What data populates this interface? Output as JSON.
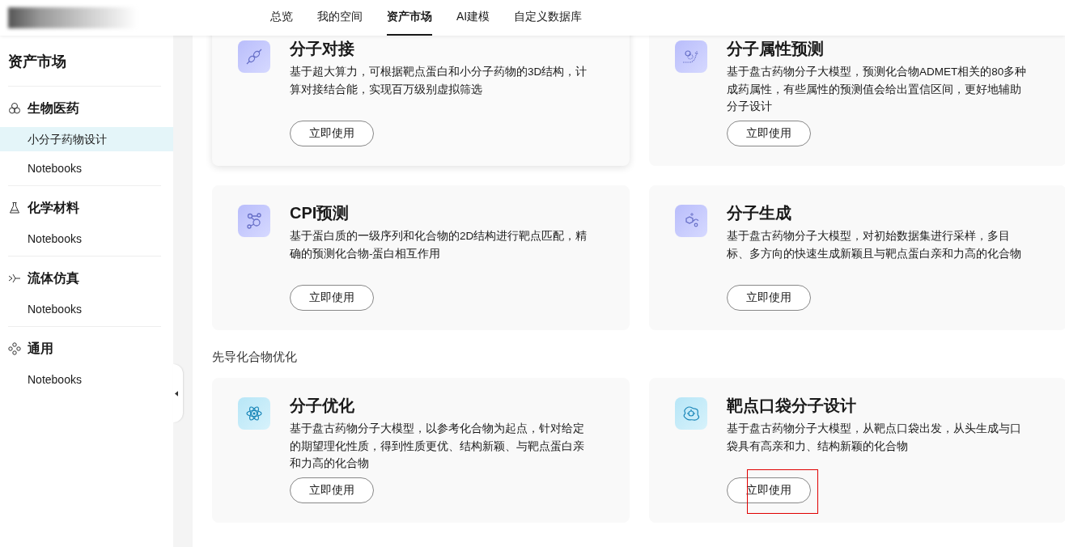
{
  "nav": {
    "tabs": [
      {
        "label": "总览",
        "selected": false
      },
      {
        "label": "我的空间",
        "selected": false
      },
      {
        "label": "资产市场",
        "selected": true
      },
      {
        "label": "AI建模",
        "selected": false
      },
      {
        "label": "自定义数据库",
        "selected": false
      }
    ]
  },
  "sidebar": {
    "title": "资产市场",
    "groups": [
      {
        "kind": "bio",
        "label": "生物医药",
        "items": [
          {
            "label": "小分子药物设计",
            "selected": true
          },
          {
            "label": "Notebooks",
            "selected": false
          }
        ]
      },
      {
        "kind": "chem",
        "label": "化学材料",
        "items": [
          {
            "label": "Notebooks",
            "selected": false
          }
        ]
      },
      {
        "kind": "fluid",
        "label": "流体仿真",
        "items": [
          {
            "label": "Notebooks",
            "selected": false
          }
        ]
      },
      {
        "kind": "general",
        "label": "通用",
        "items": [
          {
            "label": "Notebooks",
            "selected": false
          }
        ]
      }
    ]
  },
  "sections": [
    {
      "cards": [
        {
          "kind": "docking",
          "title": "分子对接",
          "description": "基于超大算力，可根据靶点蛋白和小分子药物的3D结构，计算对接结合能，实现百万级别虚拟筛选",
          "button": "立即使用",
          "hovered": true,
          "highlighted": false
        },
        {
          "kind": "property",
          "title": "分子属性预测",
          "description": "基于盘古药物分子大模型，预测化合物ADMET相关的80多种成药属性，有些属性的预测值会给出置信区间，更好地辅助分子设计",
          "button": "立即使用",
          "hovered": false,
          "highlighted": false
        },
        {
          "kind": "cpi",
          "title": "CPI预测",
          "description": "基于蛋白质的一级序列和化合物的2D结构进行靶点匹配，精确的预测化合物-蛋白相互作用",
          "button": "立即使用",
          "hovered": false,
          "highlighted": false
        },
        {
          "kind": "generate",
          "title": "分子生成",
          "description": "基于盘古药物分子大模型，对初始数据集进行采样，多目标、多方向的快速生成新颖且与靶点蛋白亲和力高的化合物",
          "button": "立即使用",
          "hovered": false,
          "highlighted": false
        }
      ]
    },
    {
      "heading": "先导化合物优化",
      "cards": [
        {
          "kind": "optimize",
          "title": "分子优化",
          "description": "基于盘古药物分子大模型，以参考化合物为起点，针对给定的期望理化性质，得到性质更优、结构新颖、与靶点蛋白亲和力高的化合物",
          "button": "立即使用",
          "hovered": false,
          "highlighted": false
        },
        {
          "kind": "pocket",
          "title": "靶点口袋分子设计",
          "description": "基于盘古药物分子大模型，从靶点口袋出发，从头生成与口袋具有高亲和力、结构新颖的化合物",
          "button": "立即使用",
          "hovered": false,
          "highlighted": true
        }
      ]
    }
  ]
}
